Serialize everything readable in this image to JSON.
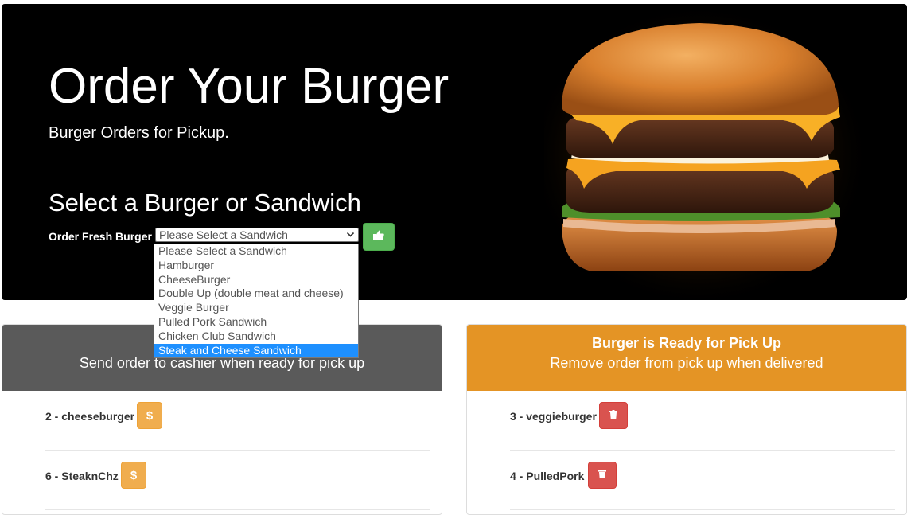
{
  "hero": {
    "title": "Order Your Burger",
    "subtitle": "Burger Orders for Pickup.",
    "section_title": "Select a Burger or Sandwich",
    "order_label": "Order Fresh Burger",
    "select_value": "Please Select a Sandwich"
  },
  "dropdown": {
    "options": [
      "Please Select a Sandwich",
      "Hamburger",
      "CheeseBurger",
      "Double Up (double meat and cheese)",
      "Veggie Burger",
      "Pulled Pork Sandwich",
      "Chicken Club Sandwich",
      "Steak and Cheese Sandwich"
    ],
    "highlighted": "Steak and Cheese Sandwich"
  },
  "pending_panel": {
    "subtitle": "Send order to cashier when ready for pick up",
    "orders": [
      "2 - cheeseburger",
      "6 - SteaknChz"
    ],
    "action_symbol": "$"
  },
  "ready_panel": {
    "title": "Burger is Ready for Pick Up",
    "subtitle": "Remove order from pick up when delivered",
    "orders": [
      "3 - veggieburger",
      "4 - PulledPork"
    ]
  },
  "colors": {
    "hero_bg": "#000000",
    "pending_header": "#5a5a5a",
    "ready_header": "#e49425",
    "submit_green": "#5cb85c",
    "warning_orange": "#f0ad4e",
    "danger_red": "#d9534f",
    "highlight_blue": "#1e90ff"
  },
  "icons": {
    "submit": "thumbs-up-icon",
    "ready_action": "trash-icon",
    "select_arrow": "chevron-down-icon"
  }
}
